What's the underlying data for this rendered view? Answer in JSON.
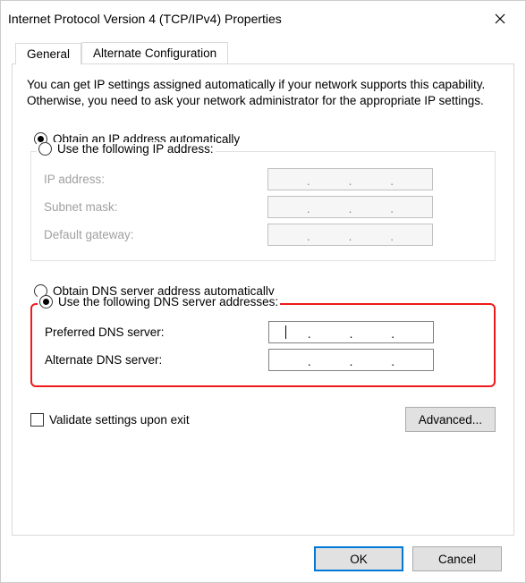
{
  "title": "Internet Protocol Version 4 (TCP/IPv4) Properties",
  "tabs": {
    "general": "General",
    "alternate": "Alternate Configuration"
  },
  "description": "You can get IP settings assigned automatically if your network supports this capability. Otherwise, you need to ask your network administrator for the appropriate IP settings.",
  "ip": {
    "auto_label": "Obtain an IP address automatically",
    "manual_label": "Use the following IP address:",
    "ip_label": "IP address:",
    "subnet_label": "Subnet mask:",
    "gateway_label": "Default gateway:",
    "ip_value": "",
    "subnet_value": "",
    "gateway_value": ""
  },
  "dns": {
    "auto_label": "Obtain DNS server address automatically",
    "manual_label": "Use the following DNS server addresses:",
    "preferred_label": "Preferred DNS server:",
    "alternate_label": "Alternate DNS server:",
    "preferred_value": "",
    "alternate_value": ""
  },
  "validate_label": "Validate settings upon exit",
  "buttons": {
    "advanced": "Advanced...",
    "ok": "OK",
    "cancel": "Cancel"
  },
  "state": {
    "ip_auto_selected": true,
    "dns_manual_selected": true,
    "validate_checked": false
  }
}
